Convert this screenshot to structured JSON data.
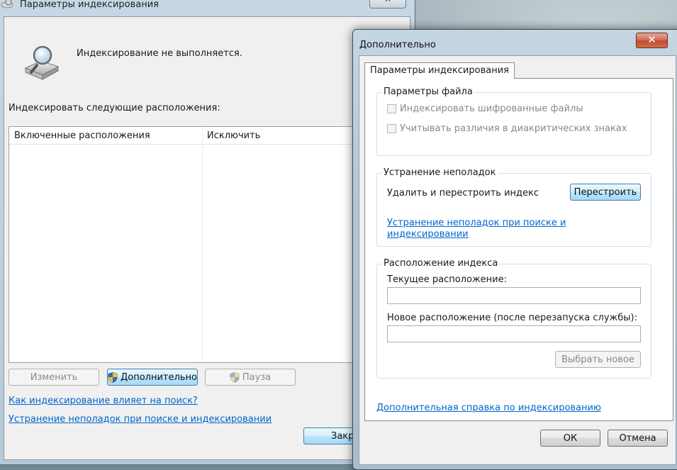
{
  "back_window": {
    "title": "Параметры индексирования",
    "close_label": "✕",
    "status": "Индексирование не выполняется.",
    "locations_label": "Индексировать следующие расположения:",
    "columns": [
      "Включенные расположения",
      "Исключить"
    ],
    "buttons": {
      "modify": "Изменить",
      "advanced": "Дополнительно",
      "pause": "Пауза",
      "close": "Закр"
    },
    "links": {
      "how_affects": "Как индексирование влияет на поиск?",
      "troubleshoot": "Устранение неполадок при поиске и индексировании"
    }
  },
  "dialog": {
    "title": "Дополнительно",
    "close_label": "✕",
    "tab_label": "Параметры индексирования",
    "file_settings": {
      "title": "Параметры файла",
      "encrypted": "Индексировать шифрованные файлы",
      "diacritics": "Учитывать различия в диакритических знаках"
    },
    "troubleshooting": {
      "title": "Устранение неполадок",
      "rebuild_text": "Удалить и перестроить индекс",
      "rebuild_button": "Перестроить",
      "link_line1": "Устранение неполадок при поиске и",
      "link_line2": "индексировании"
    },
    "index_location": {
      "title": "Расположение индекса",
      "current_label": "Текущее расположение:",
      "current_value": "",
      "new_label": "Новое расположение (после перезапуска службы):",
      "new_value": "",
      "select_new_button": "Выбрать новое"
    },
    "help_link": "Дополнительная справка по индексированию",
    "ok_button": "ОК",
    "cancel_button": "Отмена"
  }
}
